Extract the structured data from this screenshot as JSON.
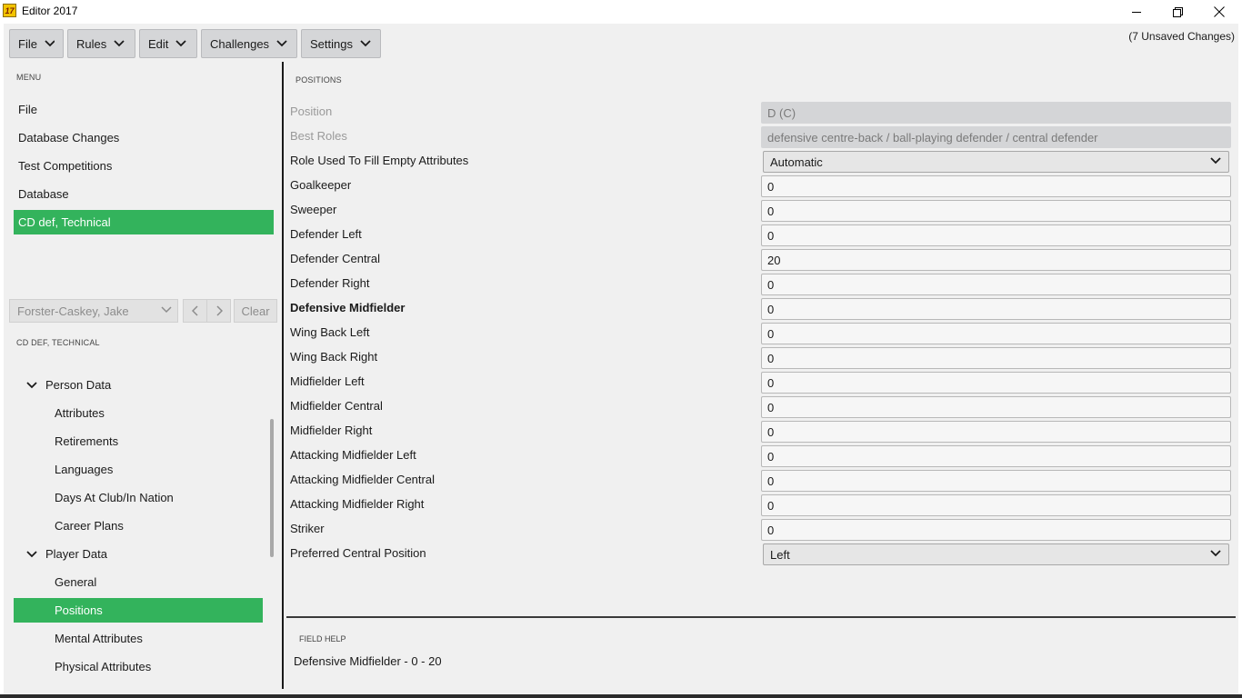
{
  "window": {
    "title": "Editor 2017",
    "logo_text": "17"
  },
  "toolbar": {
    "menus": [
      "File",
      "Rules",
      "Edit",
      "Challenges",
      "Settings"
    ],
    "unsaved": "(7 Unsaved Changes)"
  },
  "sidebar": {
    "menu_label": "MENU",
    "menu_items": [
      "File",
      "Database Changes",
      "Test Competitions",
      "Database",
      "CD def, Technical"
    ],
    "active_menu_index": 4,
    "person_select": "Forster-Caskey, Jake",
    "clear_label": "Clear",
    "section_label": "CD DEF, TECHNICAL",
    "tree": {
      "person_data": {
        "label": "Person Data",
        "children": [
          "Attributes",
          "Retirements",
          "Languages",
          "Days At Club/In Nation",
          "Career Plans"
        ]
      },
      "player_data": {
        "label": "Player Data",
        "children": [
          "General",
          "Positions",
          "Mental Attributes",
          "Physical Attributes"
        ]
      }
    }
  },
  "content": {
    "section_label": "POSITIONS",
    "rows": {
      "position": {
        "label": "Position",
        "value": "D (C)"
      },
      "best_roles": {
        "label": "Best Roles",
        "value": "defensive centre-back / ball-playing defender / central defender"
      },
      "role_fill": {
        "label": "Role Used To Fill Empty Attributes",
        "value": "Automatic"
      },
      "fields": [
        {
          "label": "Goalkeeper",
          "value": "0"
        },
        {
          "label": "Sweeper",
          "value": "0"
        },
        {
          "label": "Defender Left",
          "value": "0"
        },
        {
          "label": "Defender Central",
          "value": "20"
        },
        {
          "label": "Defender Right",
          "value": "0"
        },
        {
          "label": "Defensive Midfielder",
          "value": "0"
        },
        {
          "label": "Wing Back Left",
          "value": "0"
        },
        {
          "label": "Wing Back Right",
          "value": "0"
        },
        {
          "label": "Midfielder Left",
          "value": "0"
        },
        {
          "label": "Midfielder Central",
          "value": "0"
        },
        {
          "label": "Midfielder Right",
          "value": "0"
        },
        {
          "label": "Attacking Midfielder Left",
          "value": "0"
        },
        {
          "label": "Attacking Midfielder Central",
          "value": "0"
        },
        {
          "label": "Attacking Midfielder Right",
          "value": "0"
        },
        {
          "label": "Striker",
          "value": "0"
        }
      ],
      "preferred_central": {
        "label": "Preferred Central Position",
        "value": "Left"
      }
    },
    "field_help_label": "FIELD HELP",
    "field_help_text": "Defensive Midfielder - 0 - 20"
  },
  "colors": {
    "accent": "#33b35c",
    "panel": "#f0f0f0"
  }
}
